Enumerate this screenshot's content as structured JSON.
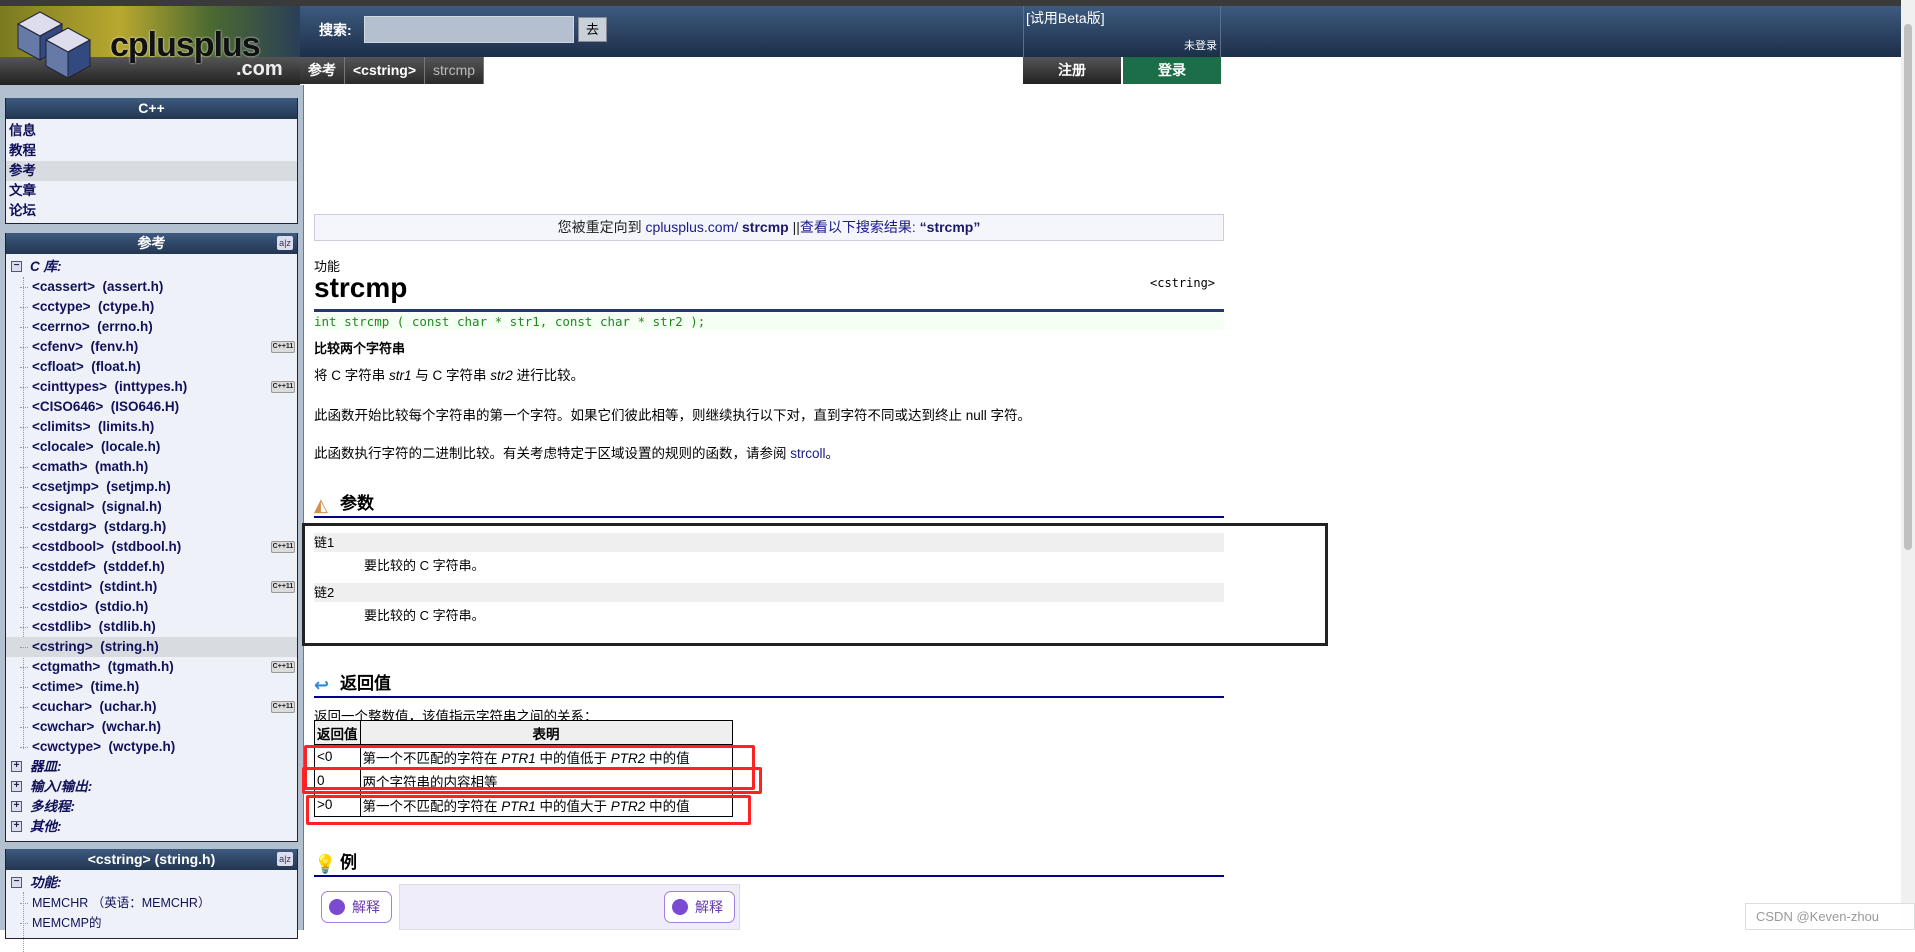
{
  "header": {
    "logo_text": "cplusplus",
    "logo_com": ".com",
    "search_label": "搜索:",
    "search_value": "",
    "search_button": "去",
    "beta": "[试用Beta版]",
    "login_status": "未登录",
    "register": "注册",
    "login": "登录"
  },
  "breadcrumb": [
    "参考",
    "<cstring>",
    "strcmp"
  ],
  "sidebar": {
    "cpp": {
      "title": "C++",
      "items": [
        "信息",
        "教程",
        "参考",
        "文章",
        "论坛"
      ],
      "selected": 2
    },
    "reference": {
      "title": "参考",
      "az": "a|z",
      "group": "C 库:",
      "items": [
        {
          "label": "<cassert>  (assert.h)"
        },
        {
          "label": "<cctype>  (ctype.h)"
        },
        {
          "label": "<cerrno>  (errno.h)"
        },
        {
          "label": "<cfenv>  (fenv.h)",
          "badge": "C++11"
        },
        {
          "label": "<cfloat>  (float.h)"
        },
        {
          "label": "<cinttypes>  (inttypes.h)",
          "badge": "C++11"
        },
        {
          "label": "<CISO646>  (ISO646.H)"
        },
        {
          "label": "<climits>  (limits.h)"
        },
        {
          "label": "<clocale>  (locale.h)"
        },
        {
          "label": "<cmath>  (math.h)"
        },
        {
          "label": "<csetjmp>  (setjmp.h)"
        },
        {
          "label": "<csignal>  (signal.h)"
        },
        {
          "label": "<cstdarg>  (stdarg.h)"
        },
        {
          "label": "<cstdbool>  (stdbool.h)",
          "badge": "C++11"
        },
        {
          "label": "<cstddef>  (stddef.h)"
        },
        {
          "label": "<cstdint>  (stdint.h)",
          "badge": "C++11"
        },
        {
          "label": "<cstdio>  (stdio.h)"
        },
        {
          "label": "<cstdlib>  (stdlib.h)"
        },
        {
          "label": "<cstring>  (string.h)"
        },
        {
          "label": "<ctgmath>  (tgmath.h)",
          "badge": "C++11"
        },
        {
          "label": "<ctime>  (time.h)"
        },
        {
          "label": "<cuchar>  (uchar.h)",
          "badge": "C++11"
        },
        {
          "label": "<cwchar>  (wchar.h)"
        },
        {
          "label": "<cwctype>  (wctype.h)"
        }
      ],
      "collapsed": [
        "器皿:",
        "输入/输出:",
        "多线程:",
        "其他:"
      ]
    },
    "cstring": {
      "title": "<cstring>  (string.h)",
      "group": "功能:",
      "items": [
        "MEMCHR （英语：MEMCHR）",
        "MEMCMP的"
      ]
    }
  },
  "main": {
    "redirect": {
      "prefix": "您被重定向到 ",
      "site": "cplusplus.com/ ",
      "name": "strcmp",
      "sep": " ||",
      "link": "查看以下搜索结果: ",
      "query": "“strcmp”"
    },
    "kind": "功能",
    "title": "strcmp",
    "header": "<cstring>",
    "prototype": "int strcmp ( const char * str1, const char * str2 );",
    "brief": "比较两个字符串",
    "p1": {
      "a": "将 C 字符串 ",
      "b": "str1",
      "c": " 与 C 字符串 ",
      "d": "str2",
      "e": " 进行比较。"
    },
    "p2": "此函数开始比较每个字符串的第一个字符。如果它们彼此相等，则继续执行以下对，直到字符不同或达到终止 null 字符。",
    "p3": {
      "a": "此函数执行字符的二进制比较。有关考虑特定于区域设置的规则的函数，请参阅 ",
      "link": "strcoll",
      "b": "。"
    },
    "params": {
      "heading": "参数",
      "items": [
        {
          "name": "链1",
          "desc": "要比较的 C 字符串。"
        },
        {
          "name": "链2",
          "desc": "要比较的 C 字符串。"
        }
      ]
    },
    "ret": {
      "heading": "返回值",
      "text": "返回一个整数值，该值指示字符串之间的关系：",
      "cols": [
        "返回值",
        "表明"
      ],
      "rows": [
        {
          "v": "<0",
          "a": "第一个不匹配的字符在 ",
          "p1": "PTR1",
          "b": " 中的值低于 ",
          "p2": "PTR2",
          "c": " 中的值"
        },
        {
          "v": "0",
          "a": "两个字符串的内容相等",
          "p1": "",
          "b": "",
          "p2": "",
          "c": ""
        },
        {
          "v": ">0",
          "a": "第一个不匹配的字符在 ",
          "p1": "PTR1",
          "b": " 中的值大于 ",
          "p2": "PTR2",
          "c": " 中的值"
        }
      ]
    },
    "example": {
      "heading": "例",
      "explain": "解释"
    }
  },
  "watermark": "CSDN @Keven-zhou",
  "colors": {
    "accent": "#00008b",
    "header": "#2a4466",
    "login": "#1c6e48",
    "highlight": "#ff2222"
  }
}
